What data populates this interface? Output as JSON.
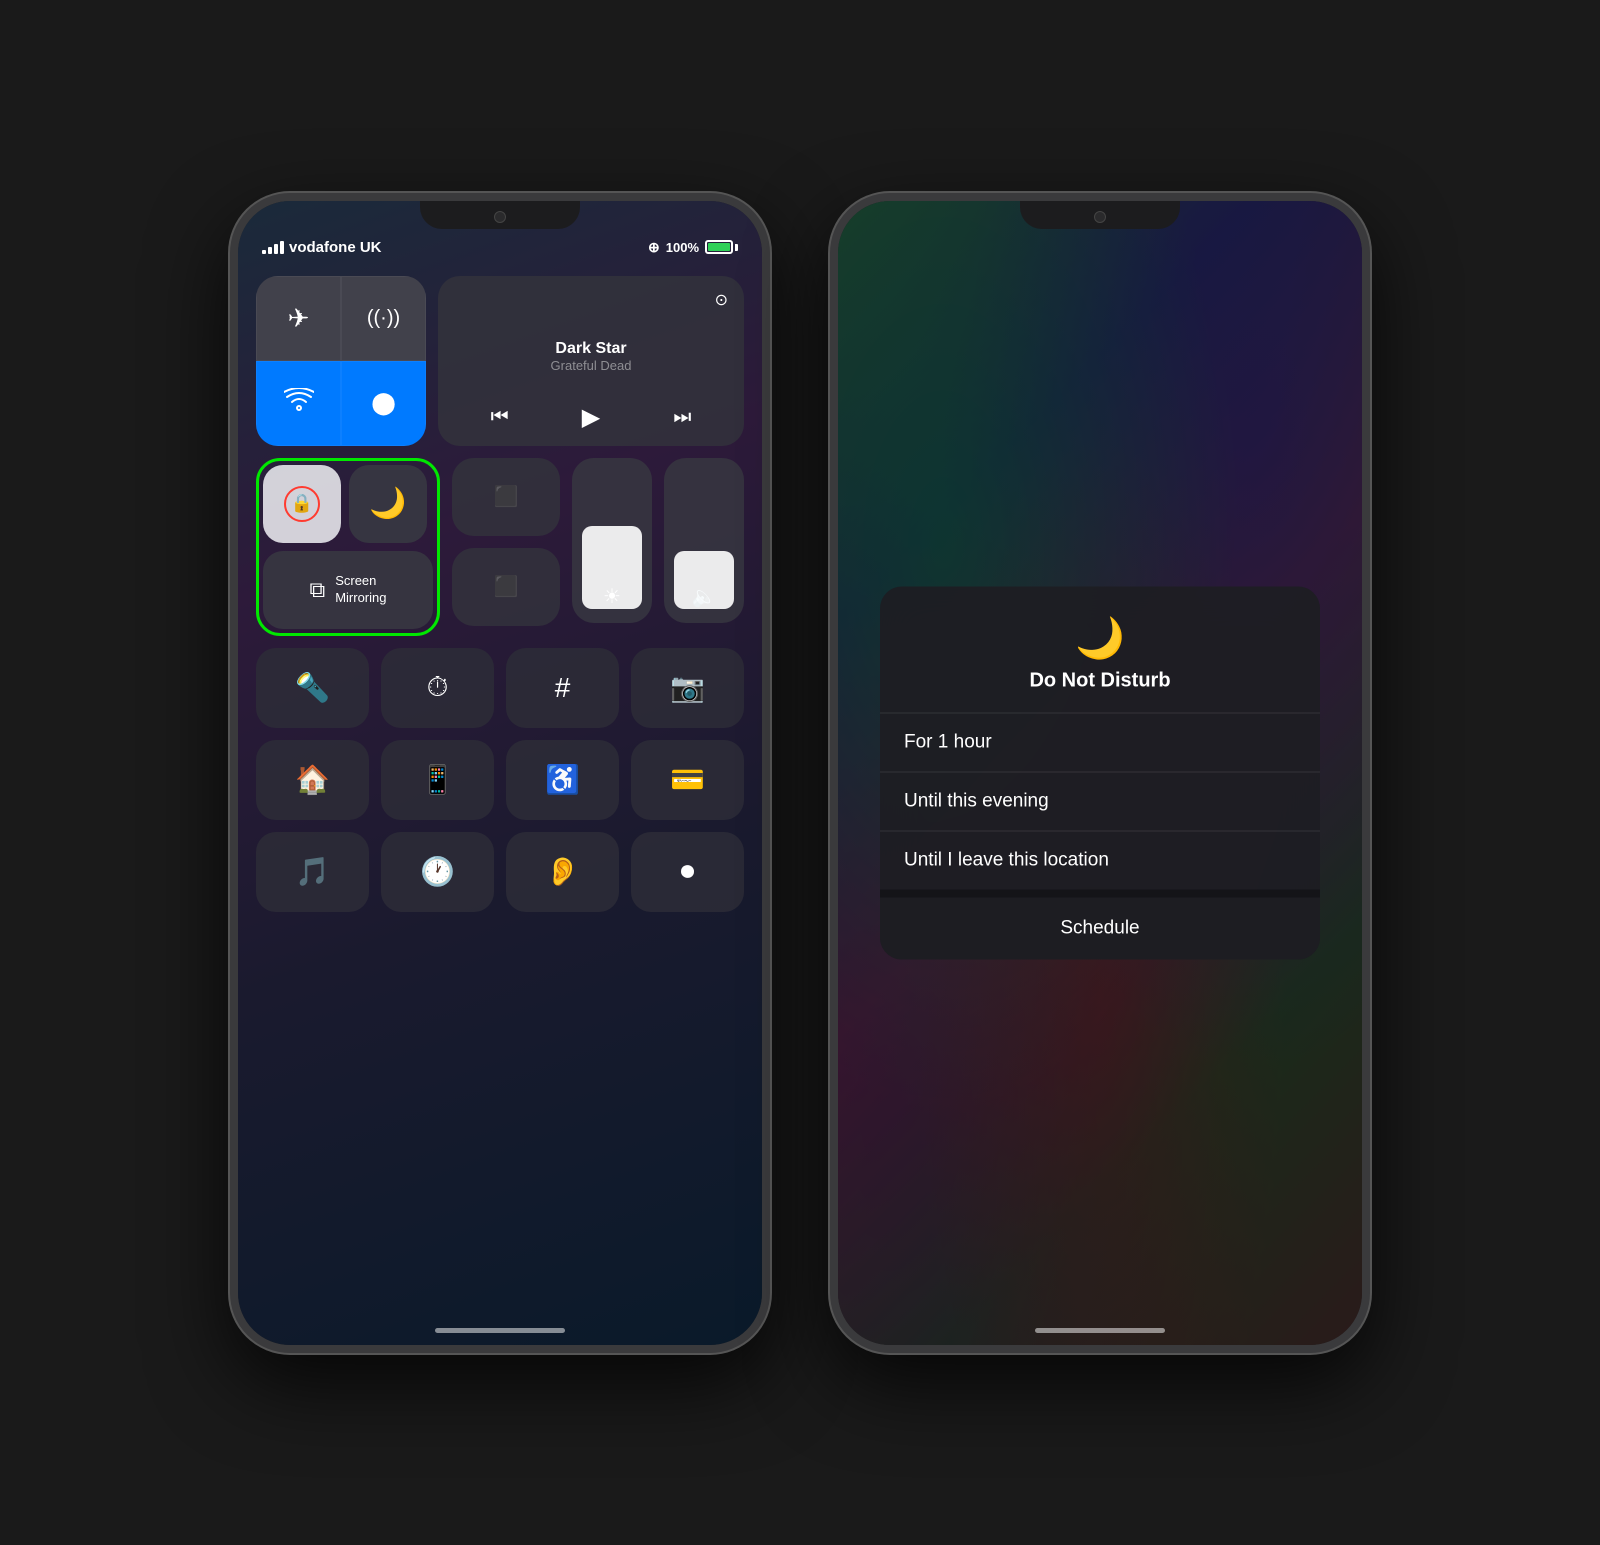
{
  "phone1": {
    "status": {
      "carrier": "vodafone UK",
      "location_icon": "⊕",
      "battery_percent": "100%",
      "charging": true
    },
    "media": {
      "title": "Dark Star",
      "artist": "Grateful Dead",
      "airplay_icon": "⊙"
    },
    "connectivity": {
      "airplane_label": "✈",
      "cellular_label": "((·))",
      "wifi_label": "wifi",
      "bluetooth_label": "bluetooth"
    },
    "highlighted": {
      "lock_label": "rotation lock",
      "moon_label": "do not disturb",
      "screen_mirroring_label": "Screen\nMirroring"
    },
    "sliders": {
      "brightness_icon": "☀",
      "volume_icon": "🔈"
    },
    "bottom_row1": [
      "flashlight",
      "timer",
      "calculator",
      "camera"
    ],
    "bottom_row2": [
      "home",
      "remote",
      "accessibility",
      "wallet"
    ],
    "bottom_row3": [
      "shazam",
      "stopwatch",
      "hearing",
      "screen_record"
    ]
  },
  "phone2": {
    "dnd": {
      "moon_icon": "🌙",
      "title": "Do Not Disturb",
      "option1": "For 1 hour",
      "option2": "Until this evening",
      "option3": "Until I leave this location",
      "schedule": "Schedule"
    }
  }
}
